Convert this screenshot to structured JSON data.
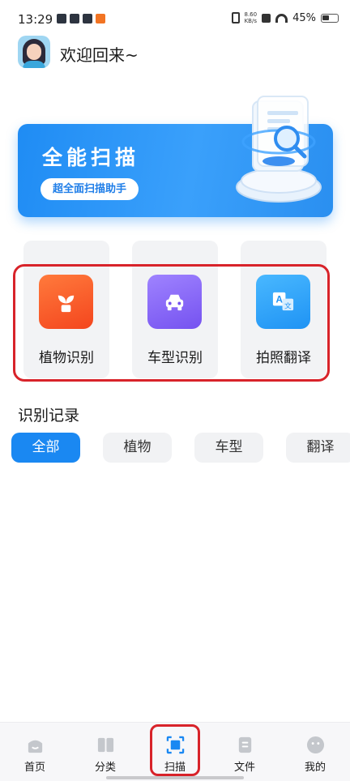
{
  "status_bar": {
    "time": "13:29",
    "speed_value": "8.60",
    "speed_unit": "KB/s",
    "battery": "45%"
  },
  "header": {
    "welcome": "欢迎回来~"
  },
  "banner": {
    "title": "全能扫描",
    "button_label": "超全面扫描助手"
  },
  "features": [
    {
      "label": "植物识别",
      "icon": "plant-icon",
      "color": "#f4461e"
    },
    {
      "label": "车型识别",
      "icon": "car-icon",
      "color": "#7552f0"
    },
    {
      "label": "拍照翻译",
      "icon": "translate-icon",
      "color": "#1f93f4"
    }
  ],
  "records": {
    "title": "识别记录",
    "filters": [
      "全部",
      "植物",
      "车型",
      "翻译"
    ],
    "active_filter": "全部"
  },
  "bottom_nav": {
    "items": [
      {
        "label": "首页",
        "icon": "home-icon"
      },
      {
        "label": "分类",
        "icon": "book-icon"
      },
      {
        "label": "扫描",
        "icon": "scan-icon"
      },
      {
        "label": "文件",
        "icon": "file-icon"
      },
      {
        "label": "我的",
        "icon": "profile-icon"
      }
    ],
    "active": "扫描"
  },
  "colors": {
    "accent": "#1a88f2",
    "highlight_box": "#d8232a"
  }
}
